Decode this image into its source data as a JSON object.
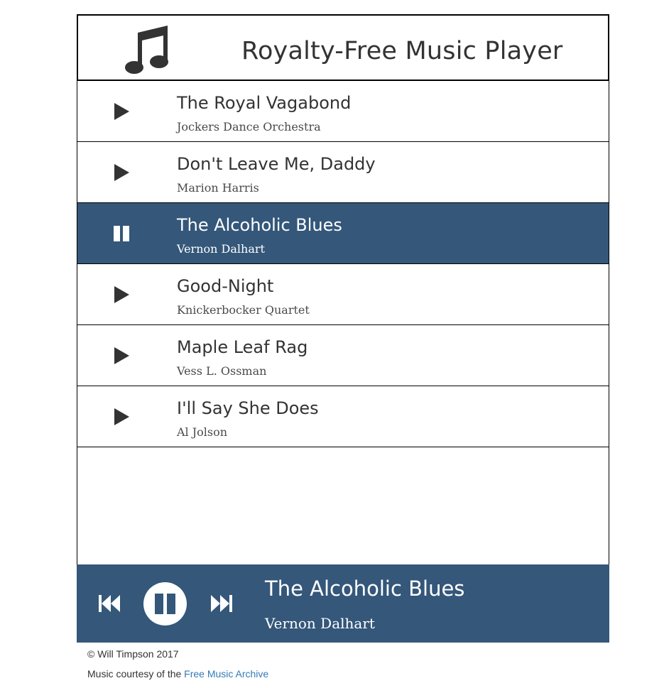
{
  "header": {
    "title": "Royalty-Free Music Player",
    "icon": "music-note-icon"
  },
  "tracks": [
    {
      "title": "The Royal Vagabond",
      "artist": "Jockers Dance Orchestra",
      "state": "play"
    },
    {
      "title": "Don't Leave Me, Daddy",
      "artist": "Marion Harris",
      "state": "play"
    },
    {
      "title": "The Alcoholic Blues",
      "artist": "Vernon Dalhart",
      "state": "pause"
    },
    {
      "title": "Good-Night",
      "artist": "Knickerbocker Quartet",
      "state": "play"
    },
    {
      "title": "Maple Leaf Rag",
      "artist": "Vess L. Ossman",
      "state": "play"
    },
    {
      "title": "I'll Say She Does",
      "artist": "Al Jolson",
      "state": "play"
    }
  ],
  "now_playing": {
    "title": "The Alcoholic Blues",
    "artist": "Vernon Dalhart",
    "controls": [
      "previous-icon",
      "pause-icon",
      "next-icon"
    ]
  },
  "footer": {
    "copyright": "© Will Timpson 2017",
    "courtesy_prefix": "Music courtesy of the ",
    "courtesy_link": "Free Music Archive"
  },
  "colors": {
    "accent": "#34577a",
    "text": "#333333",
    "link": "#337ab7"
  }
}
